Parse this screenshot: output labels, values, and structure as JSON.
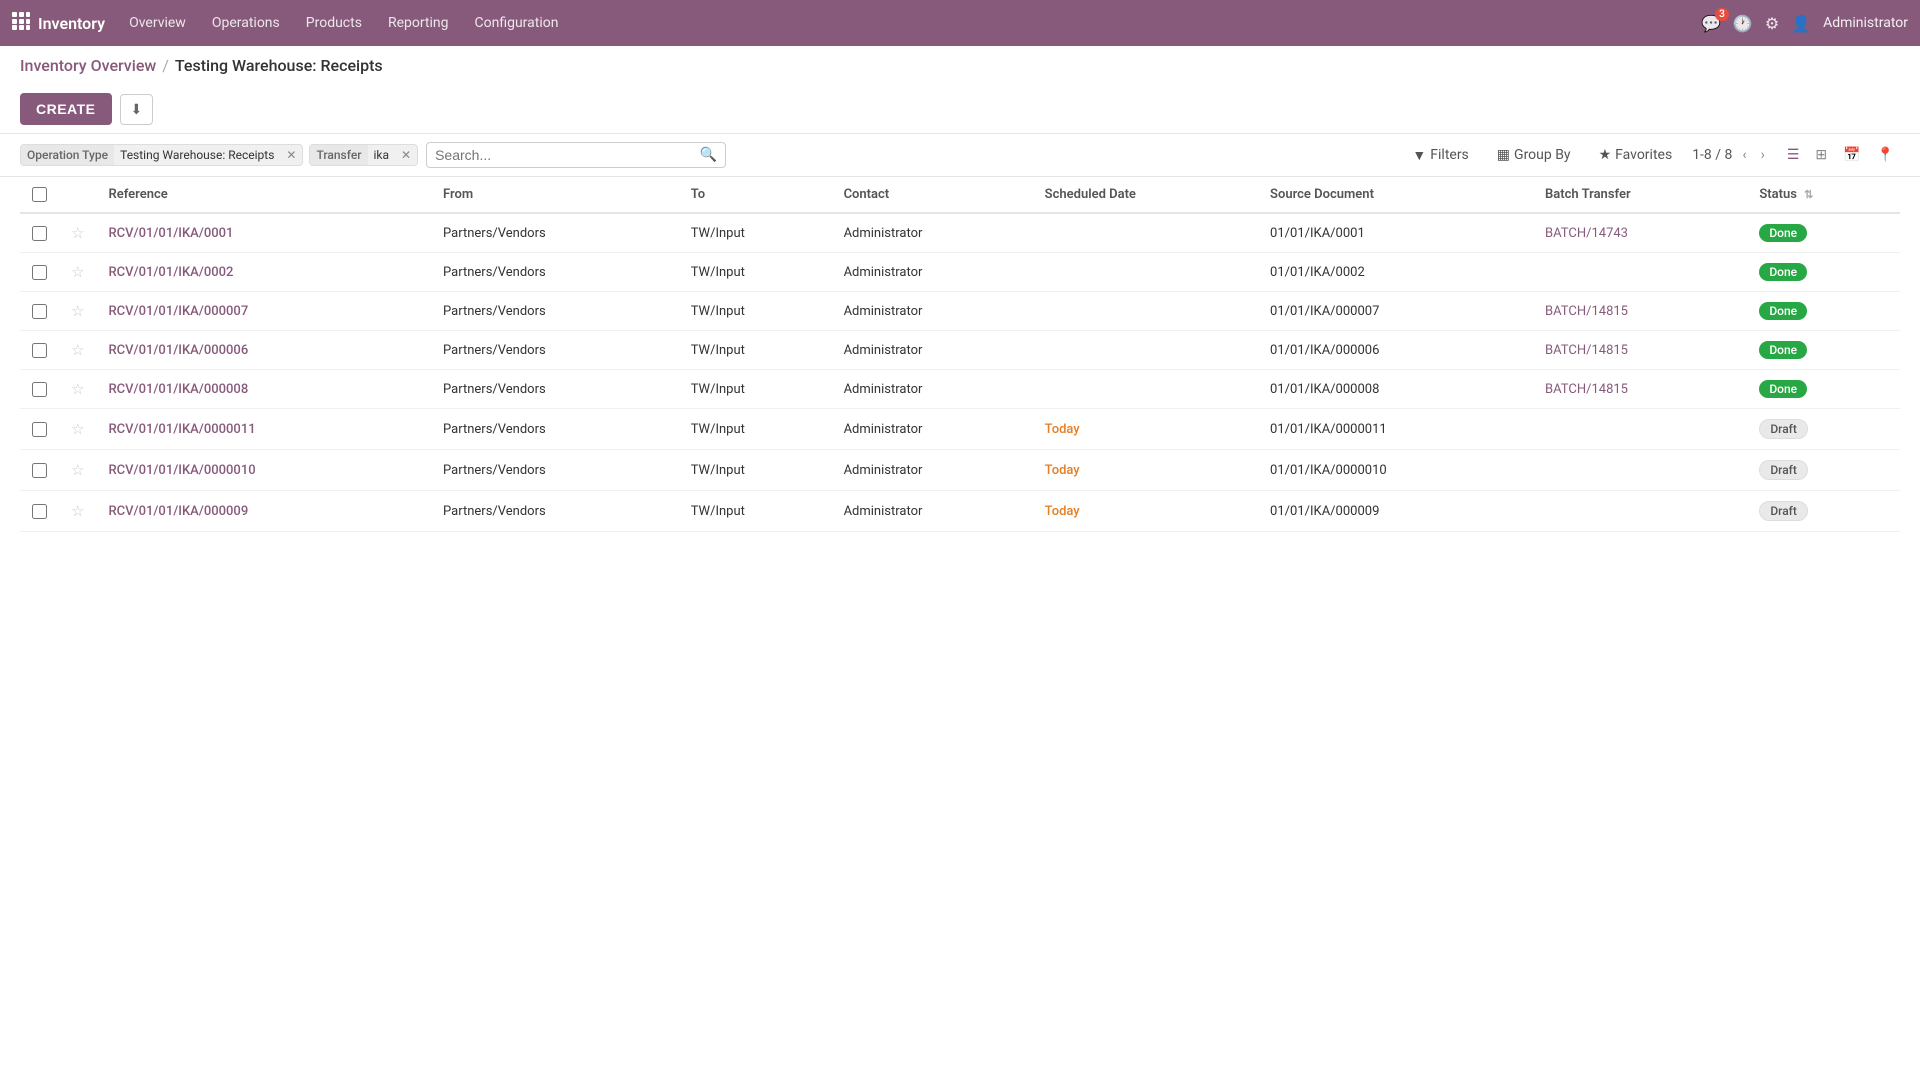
{
  "app": {
    "logo_label": "Inventory",
    "nav_items": [
      "Overview",
      "Operations",
      "Products",
      "Reporting",
      "Configuration"
    ],
    "notifications_count": "3",
    "user": "Administrator"
  },
  "breadcrumb": {
    "parent": "Inventory Overview",
    "separator": "/",
    "current": "Testing Warehouse: Receipts"
  },
  "toolbar": {
    "create_label": "CREATE",
    "download_label": "⬇"
  },
  "filters": {
    "operation_type_label": "Operation Type",
    "operation_type_value": "Testing Warehouse: Receipts",
    "transfer_label": "Transfer",
    "transfer_value": "ika",
    "search_placeholder": "Search...",
    "filters_btn": "Filters",
    "groupby_btn": "Group By",
    "favorites_btn": "Favorites",
    "pagination": "1-8 / 8"
  },
  "table": {
    "columns": [
      "Reference",
      "From",
      "To",
      "Contact",
      "Scheduled Date",
      "Source Document",
      "Batch Transfer",
      "Status"
    ],
    "rows": [
      {
        "reference": "RCV/01/01/IKA/0001",
        "from": "Partners/Vendors",
        "to": "TW/Input",
        "contact": "Administrator",
        "scheduled_date": "",
        "source_document": "01/01/IKA/0001",
        "batch_transfer": "BATCH/14743",
        "status": "Done",
        "status_type": "done"
      },
      {
        "reference": "RCV/01/01/IKA/0002",
        "from": "Partners/Vendors",
        "to": "TW/Input",
        "contact": "Administrator",
        "scheduled_date": "",
        "source_document": "01/01/IKA/0002",
        "batch_transfer": "",
        "status": "Done",
        "status_type": "done"
      },
      {
        "reference": "RCV/01/01/IKA/000007",
        "from": "Partners/Vendors",
        "to": "TW/Input",
        "contact": "Administrator",
        "scheduled_date": "",
        "source_document": "01/01/IKA/000007",
        "batch_transfer": "BATCH/14815",
        "status": "Done",
        "status_type": "done"
      },
      {
        "reference": "RCV/01/01/IKA/000006",
        "from": "Partners/Vendors",
        "to": "TW/Input",
        "contact": "Administrator",
        "scheduled_date": "",
        "source_document": "01/01/IKA/000006",
        "batch_transfer": "BATCH/14815",
        "status": "Done",
        "status_type": "done"
      },
      {
        "reference": "RCV/01/01/IKA/000008",
        "from": "Partners/Vendors",
        "to": "TW/Input",
        "contact": "Administrator",
        "scheduled_date": "",
        "source_document": "01/01/IKA/000008",
        "batch_transfer": "BATCH/14815",
        "status": "Done",
        "status_type": "done"
      },
      {
        "reference": "RCV/01/01/IKA/0000011",
        "from": "Partners/Vendors",
        "to": "TW/Input",
        "contact": "Administrator",
        "scheduled_date": "Today",
        "source_document": "01/01/IKA/0000011",
        "batch_transfer": "",
        "status": "Draft",
        "status_type": "draft"
      },
      {
        "reference": "RCV/01/01/IKA/0000010",
        "from": "Partners/Vendors",
        "to": "TW/Input",
        "contact": "Administrator",
        "scheduled_date": "Today",
        "source_document": "01/01/IKA/0000010",
        "batch_transfer": "",
        "status": "Draft",
        "status_type": "draft"
      },
      {
        "reference": "RCV/01/01/IKA/000009",
        "from": "Partners/Vendors",
        "to": "TW/Input",
        "contact": "Administrator",
        "scheduled_date": "Today",
        "source_document": "01/01/IKA/000009",
        "batch_transfer": "",
        "status": "Draft",
        "status_type": "draft"
      }
    ]
  }
}
